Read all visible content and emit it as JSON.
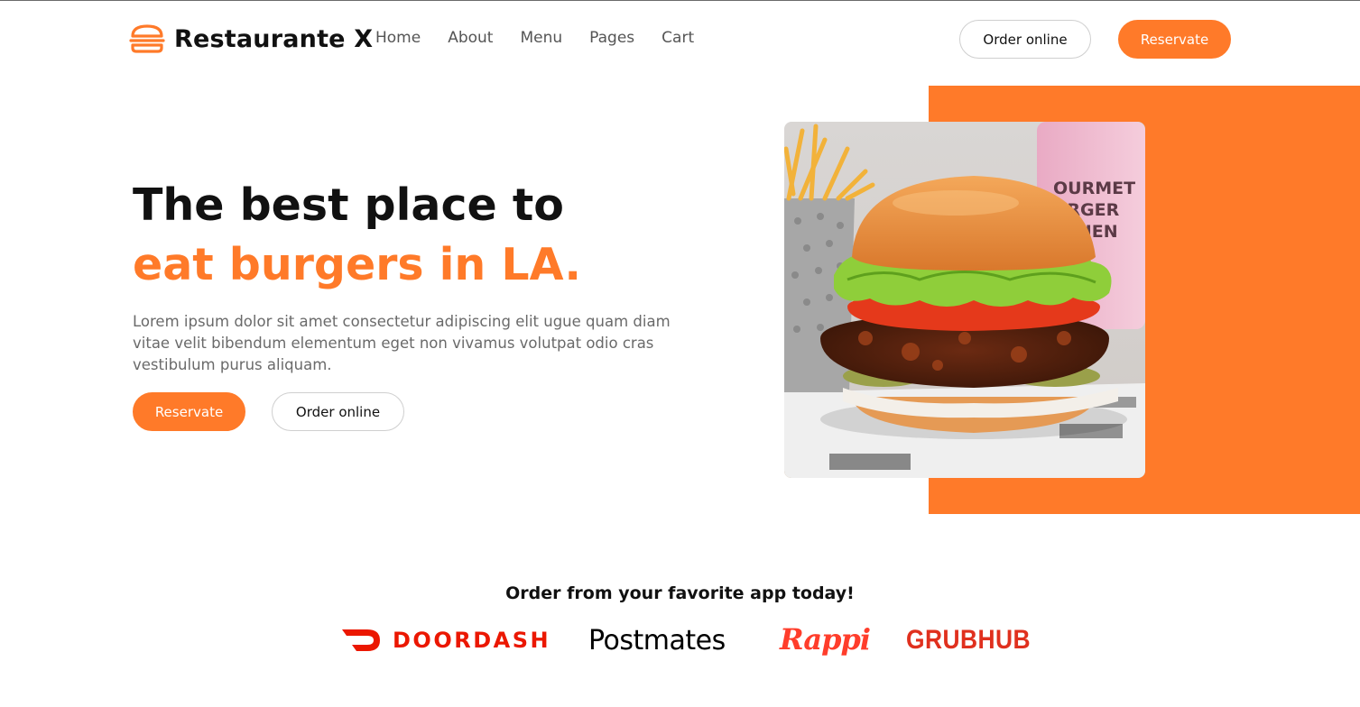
{
  "nav": {
    "brand_name": "Restaurante X",
    "brand_icon": "burger-icon",
    "links": [
      "Home",
      "About",
      "Menu",
      "Pages",
      "Cart"
    ],
    "order_online_label": "Order online",
    "reservate_label": "Reservate"
  },
  "hero": {
    "title_line1": "The best place to",
    "title_line2": "eat burgers in LA.",
    "description": "Lorem ipsum dolor sit amet consectetur adipiscing elit ugue quam diam vitae velit bibendum elementum eget non vivamus volutpat odio cras vestibulum purus aliquam.",
    "reservate_label": "Reservate",
    "order_online_label": "Order online",
    "image_caption": "GOURMET BURGER KITCHEN"
  },
  "apps": {
    "title": "Order from your favorite app today!",
    "doordash": "DOORDASH",
    "postmates": "Postmates",
    "rappi": "Rappi",
    "grubhub": "GRUBHUB"
  },
  "colors": {
    "accent": "#ff7a29",
    "doordash": "#eb1700",
    "rappi": "#ff3d2b",
    "grubhub": "#e0301e"
  }
}
